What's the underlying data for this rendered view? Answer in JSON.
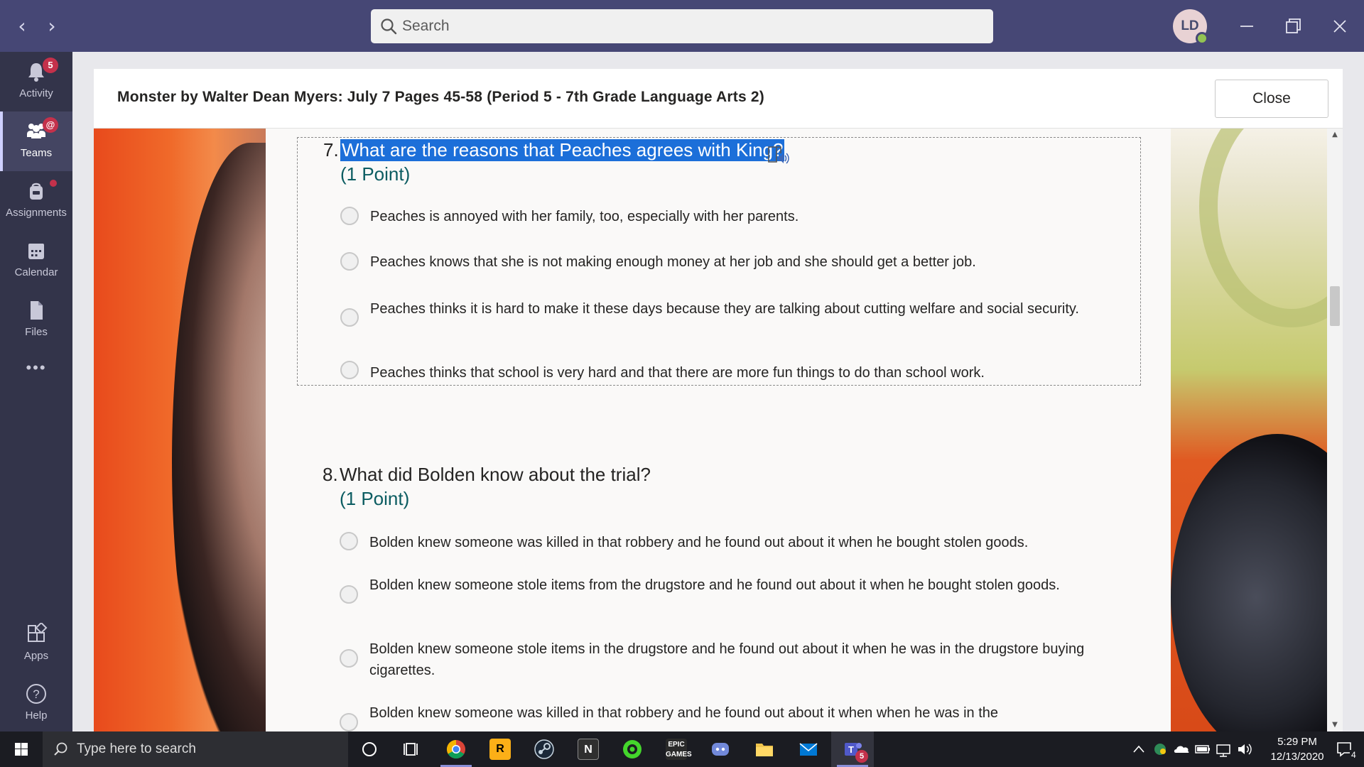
{
  "titlebar": {
    "search_placeholder": "Search",
    "avatar_initials": "LD"
  },
  "rail": {
    "items": [
      {
        "label": "Activity",
        "badge": "5"
      },
      {
        "label": "Teams",
        "badge": "@"
      },
      {
        "label": "Assignments"
      },
      {
        "label": "Calendar"
      },
      {
        "label": "Files"
      },
      {
        "label": "Apps"
      },
      {
        "label": "Help"
      }
    ],
    "more": "•••"
  },
  "dialog": {
    "title": "Monster by Walter Dean Myers: July 7 Pages 45-58 (Period 5 - 7th Grade Language Arts 2)",
    "close_label": "Close"
  },
  "questions": [
    {
      "number": "7.",
      "text": "What are the reasons that Peaches agrees with King?",
      "points": "(1 Point)",
      "options": [
        "Peaches is annoyed with her family, too, especially with her parents.",
        "Peaches knows that she is not making enough money at her job and she should get a better job.",
        "Peaches thinks it is hard to make it these days because they are talking about cutting welfare and social security.",
        "Peaches thinks that school is very hard and that there are more fun things to do than school work."
      ]
    },
    {
      "number": "8.",
      "text": "What did Bolden know about the trial?",
      "points": "(1 Point)",
      "options": [
        "Bolden knew someone was killed in that robbery and he found out about it when he bought stolen goods.",
        "Bolden knew someone stole items from the drugstore and he found out about it when he bought stolen goods.",
        "Bolden knew someone stole items in the drugstore and he found out about it when he was in the drugstore buying cigarettes.",
        "Bolden knew someone was killed in that robbery and he found out about it when when he was in the"
      ]
    }
  ],
  "taskbar": {
    "search_placeholder": "Type here to search",
    "teams_badge": "5",
    "time": "5:29 PM",
    "date": "12/13/2020",
    "notification_count": "4"
  },
  "colors": {
    "titlebar": "#464775",
    "rail": "#33344a",
    "selection": "#1c6fd9",
    "points": "#0b5c61",
    "badge": "#c4314b"
  }
}
